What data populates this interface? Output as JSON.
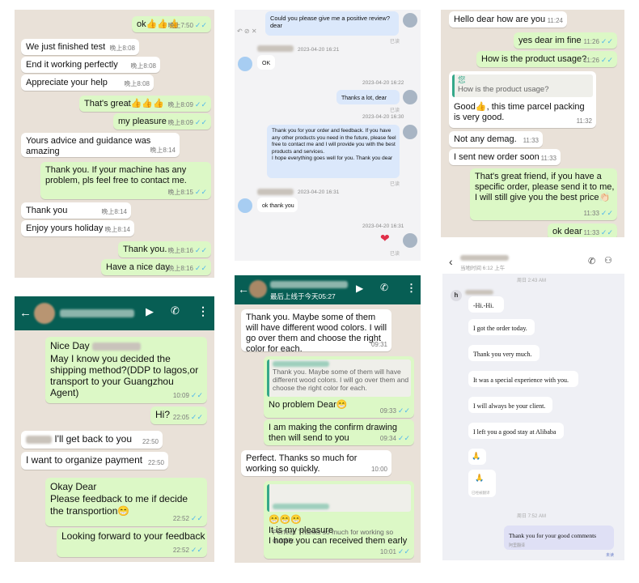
{
  "panel1": {
    "messages": [
      {
        "dir": "out",
        "text": "ok👍👍👍",
        "time": "晚上7:50"
      },
      {
        "dir": "in",
        "text": "We just finished test",
        "time": "晚上8:08"
      },
      {
        "dir": "in",
        "text": "End it working perfectly",
        "time": "晚上8:08"
      },
      {
        "dir": "in",
        "text": "Appreciate your help",
        "time": "晚上8:08"
      },
      {
        "dir": "out",
        "text": "That's great👍👍👍",
        "time": "晚上8:09"
      },
      {
        "dir": "out",
        "text": "my pleasure",
        "time": "晚上8:09"
      },
      {
        "dir": "in",
        "text": "Yours advice and guidance was amazing",
        "time": "晚上8:14"
      },
      {
        "dir": "out",
        "text": "Thank you. If your machine has any problem, pls feel free to contact me.",
        "time": "晚上8:15"
      },
      {
        "dir": "in",
        "text": "Thank you",
        "time": "晚上8:14"
      },
      {
        "dir": "in",
        "text": "Enjoy yours holiday",
        "time": "晚上8:14"
      },
      {
        "dir": "out",
        "text": "Thank you.",
        "time": "晚上8:16"
      },
      {
        "dir": "out",
        "text": "Have a nice day",
        "time": "晚上8:16"
      }
    ]
  },
  "panel2": {
    "messages": [
      {
        "text": "Could you please give me a positive review? dear",
        "status": "已读"
      },
      {
        "date": "2023-04-20 16:21",
        "text": "OK"
      },
      {
        "date": "2023-04-20 16:22",
        "text": "Thanks a lot, dear",
        "status": "已读"
      },
      {
        "date": "2023-04-20 16:30",
        "text": "Thank you for your order and feedback. If you have any other products you need in the future, please feel free to contact me and I will provide you with the best products and services.\nI hope everything goes well for you. Thank you dear",
        "status": "已读"
      },
      {
        "date": "2023-04-20 16:31",
        "text": "ok thank you"
      },
      {
        "date": "2023-04-20 16:31",
        "text": "❤",
        "status": "已读"
      }
    ]
  },
  "panel3": {
    "messages": [
      {
        "dir": "in",
        "text": "Hello dear how are you",
        "time": "11:24"
      },
      {
        "dir": "out",
        "text": "yes  dear  im fine",
        "time": "11:26"
      },
      {
        "dir": "out",
        "text": "How is the product usage?",
        "time": "11:26"
      },
      {
        "dir": "in",
        "quote_author": "您",
        "quote_text": "How is the product usage?",
        "text": "Good👍, this time parcel packing is very good.",
        "time": "11:32"
      },
      {
        "dir": "in",
        "text": "Not any demag.",
        "time": "11:33"
      },
      {
        "dir": "in",
        "text": "I sent new order soon",
        "time": "11:33"
      },
      {
        "dir": "out",
        "text": "That's great friend, if you have a specific order, please send it to me, I will still give you the best price👏🏻",
        "time": "11:33"
      },
      {
        "dir": "out",
        "text": "ok dear",
        "time": "11:33"
      }
    ]
  },
  "panel4": {
    "messages": [
      {
        "dir": "in",
        "text": "Nice Day",
        "time": ""
      },
      {
        "dir": "in",
        "text": "May I know you decided the shipping method?(DDP to lagos,or transport to your Guangzhou Agent)",
        "time": "10:09"
      },
      {
        "dir": "out",
        "text": "Hi?",
        "time": "22:05"
      },
      {
        "dir": "in",
        "text": "I'll get back to you",
        "time": "22:50"
      },
      {
        "dir": "in",
        "text": "I want to organize payment",
        "time": "22:50"
      },
      {
        "dir": "out",
        "text": "Okay Dear\nPlease feedback to me if decide the transportion😁",
        "time": "22:52"
      },
      {
        "dir": "out",
        "text": "Looking forward to your feedback",
        "time": "22:52"
      }
    ]
  },
  "panel5": {
    "header_sub": "最后上线于今天05:27",
    "messages": [
      {
        "dir": "in",
        "text": "Thank you. Maybe some of them will have different wood colors. I will go over them and choose the right color for each.",
        "time": "09:31"
      },
      {
        "dir": "out",
        "quote_text": "Thank you. Maybe some of them will have different wood colors. I will go over them and choose the right color for each.",
        "text": "No problem Dear😁",
        "time": "09:33"
      },
      {
        "dir": "out",
        "text": "I am making the confirm drawing then will send to you",
        "time": "09:34"
      },
      {
        "dir": "in",
        "text": "Perfect. Thanks so much for working so quickly.",
        "time": "10:00"
      },
      {
        "dir": "out",
        "quote_text": "Perfect. Thanks so much for working so quickly.",
        "text": "😁😁😁\nIt is my pleasure\nI hope you can received them early",
        "time": "10:01"
      }
    ]
  },
  "panel6": {
    "header_sub": "当地时间 6:12 上午",
    "date1": "周日 2:43 AM",
    "avatar_letter": "h",
    "messages": [
      {
        "text": "-Hi.-Hi."
      },
      {
        "text": "I got the order today."
      },
      {
        "text": "Thank you very much."
      },
      {
        "text": "It was a special experience with you."
      },
      {
        "text": "I will always be your client."
      },
      {
        "text": "I left you a good stay at Alibaba"
      },
      {
        "text": "🙏"
      },
      {
        "text": "🙏",
        "sub": "已经被翻译"
      }
    ],
    "date2": "周日 7:52 AM",
    "reply": {
      "text": "Thank you for your good comments",
      "sub": "阿里翻译",
      "status": "未读"
    }
  }
}
